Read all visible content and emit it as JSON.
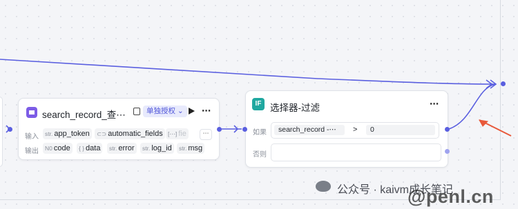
{
  "node_search": {
    "title": "search_record_查⋯",
    "auth_label": "单独授权 ⌄",
    "more": "⋯",
    "input_label": "输入",
    "inputs": [
      {
        "type": "str.",
        "name": "app_token"
      },
      {
        "type": "⊂⊃",
        "name": "automatic_fields"
      },
      {
        "type": "[⋯]",
        "name": "fie"
      }
    ],
    "inputs_more": "⋯",
    "output_label": "输出",
    "outputs": [
      {
        "type": "N0",
        "name": "code"
      },
      {
        "type": "{ }",
        "name": "data"
      },
      {
        "type": "str.",
        "name": "error"
      },
      {
        "type": "str.",
        "name": "log_id"
      },
      {
        "type": "str.",
        "name": "msg"
      }
    ]
  },
  "node_if": {
    "icon_text": "IF",
    "title": "选择器-过滤",
    "more": "⋯",
    "if_label": "如果",
    "condition_field": "search_record  -⋯",
    "condition_operator": ">",
    "condition_value": "0",
    "else_label": "否则"
  },
  "watermark": {
    "text": "公众号 · kaivm成长笔记",
    "site": "@penl.cn"
  },
  "colors": {
    "edge": "#5a5fe0",
    "arrow": "#e8593a",
    "if_icon": "#20a8a0",
    "plugin_icon": "#7c5ce6"
  }
}
